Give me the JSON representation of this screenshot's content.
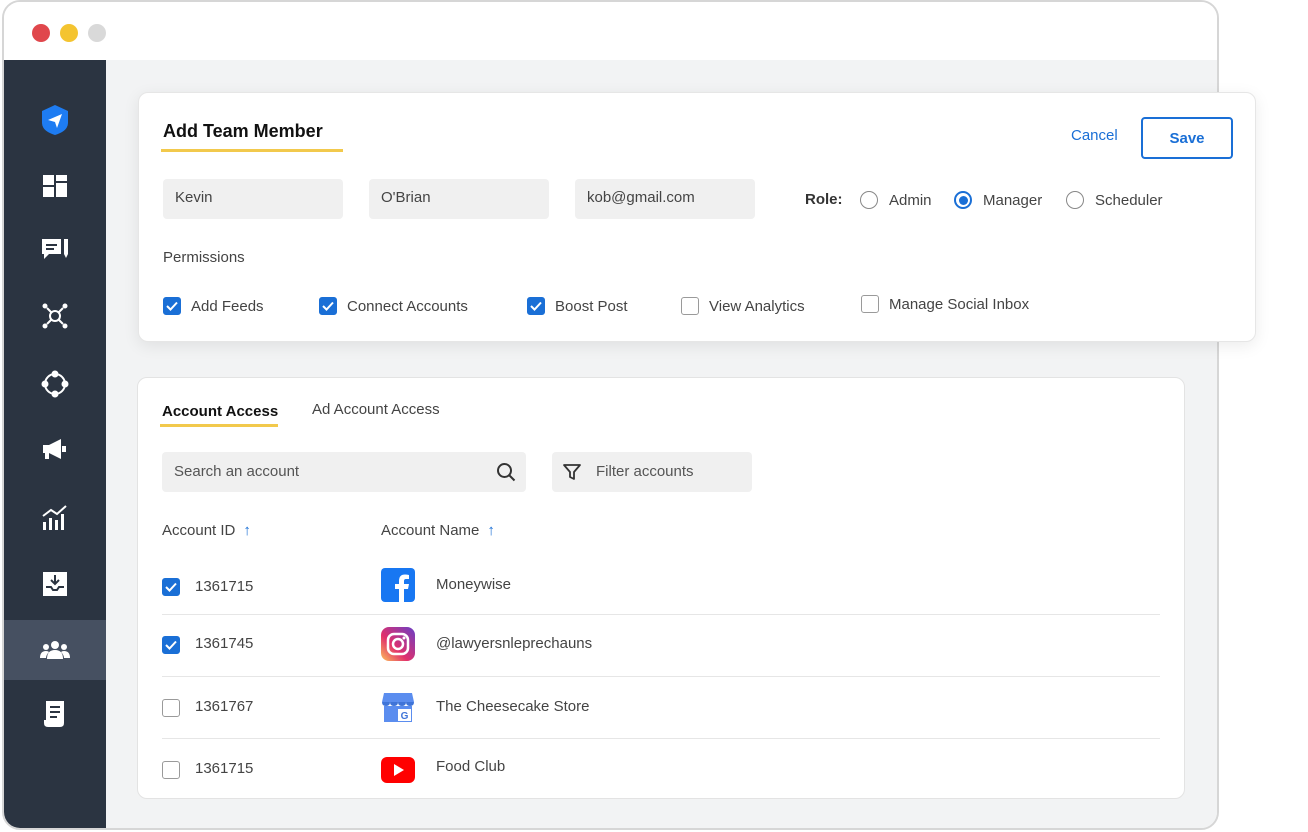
{
  "window": {
    "controls": [
      "close",
      "minimize",
      "zoom"
    ]
  },
  "sidebar": {
    "items": [
      {
        "icon": "send-logo-icon",
        "active": false
      },
      {
        "icon": "dashboard-icon",
        "active": false
      },
      {
        "icon": "compose-icon",
        "active": false
      },
      {
        "icon": "network-icon",
        "active": false
      },
      {
        "icon": "workflow-icon",
        "active": false
      },
      {
        "icon": "megaphone-icon",
        "active": false
      },
      {
        "icon": "analytics-icon",
        "active": false
      },
      {
        "icon": "inbox-download-icon",
        "active": false
      },
      {
        "icon": "team-icon",
        "active": true
      },
      {
        "icon": "report-icon",
        "active": false
      }
    ]
  },
  "add_member": {
    "title": "Add Team Member",
    "cancel_label": "Cancel",
    "save_label": "Save",
    "first_name": "Kevin",
    "last_name": "O'Brian",
    "email": "kob@gmail.com",
    "role_label": "Role:",
    "roles": [
      {
        "label": "Admin",
        "selected": false
      },
      {
        "label": "Manager",
        "selected": true
      },
      {
        "label": "Scheduler",
        "selected": false
      }
    ],
    "permissions_label": "Permissions",
    "permissions": [
      {
        "label": "Add Feeds",
        "checked": true
      },
      {
        "label": "Connect Accounts",
        "checked": true
      },
      {
        "label": "Boost Post",
        "checked": true
      },
      {
        "label": "View Analytics",
        "checked": false
      },
      {
        "label": "Manage Social Inbox",
        "checked": false
      }
    ]
  },
  "account_access": {
    "tabs": [
      {
        "label": "Account Access",
        "active": true
      },
      {
        "label": "Ad Account Access",
        "active": false
      }
    ],
    "search_placeholder": "Search an account",
    "filter_label": "Filter accounts",
    "columns": {
      "id": "Account ID",
      "name": "Account Name"
    },
    "rows": [
      {
        "checked": true,
        "id": "1361715",
        "platform": "facebook",
        "name": "Moneywise"
      },
      {
        "checked": true,
        "id": "1361745",
        "platform": "instagram",
        "name": "@lawyersnleprechauns"
      },
      {
        "checked": false,
        "id": "1361767",
        "platform": "google-business",
        "name": "The Cheesecake Store"
      },
      {
        "checked": false,
        "id": "1361715",
        "platform": "youtube",
        "name": "Food Club"
      }
    ]
  },
  "colors": {
    "sidebar": "#2b3441",
    "sidebar_active": "#465061",
    "accent": "#1a6fd6",
    "underline": "#f2c94c",
    "field_bg": "#f0f0f0"
  }
}
